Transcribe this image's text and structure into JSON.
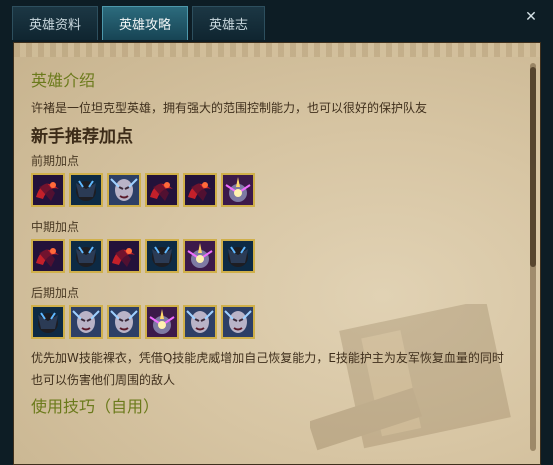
{
  "tabs": [
    {
      "label": "英雄资料",
      "active": false
    },
    {
      "label": "英雄攻略",
      "active": true
    },
    {
      "label": "英雄志",
      "active": false
    }
  ],
  "close_glyph": "✕",
  "intro": {
    "title": "英雄介绍",
    "text": "许褚是一位坦克型英雄，拥有强大的范围控制能力，也可以很好的保护队友"
  },
  "build": {
    "title": "新手推荐加点",
    "early": {
      "label": "前期加点",
      "skills": [
        "skill-w",
        "skill-q",
        "skill-e",
        "skill-w",
        "skill-w",
        "skill-r"
      ]
    },
    "mid": {
      "label": "中期加点",
      "skills": [
        "skill-w",
        "skill-q",
        "skill-w",
        "skill-q",
        "skill-r",
        "skill-q"
      ]
    },
    "late": {
      "label": "后期加点",
      "skills": [
        "skill-q",
        "skill-e",
        "skill-e",
        "skill-r",
        "skill-e",
        "skill-e"
      ]
    },
    "note_line1": "优先加W技能裸衣，凭借Q技能虎威增加自己恢复能力，E技能护主为友军恢复血量的同时",
    "note_line2": "也可以伤害他们周围的敌人"
  },
  "tips": {
    "title": "使用技巧（自用）"
  },
  "colors": {
    "accent_green": "#6b7a1b",
    "tab_active": "#2c6b7d",
    "parchment": "#d8c7a6",
    "icon_border": "#d0b04a"
  }
}
